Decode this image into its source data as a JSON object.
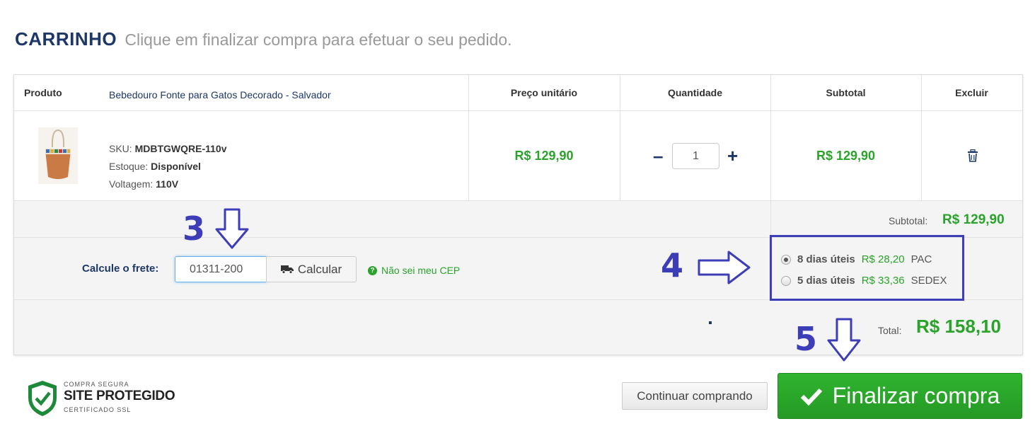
{
  "header": {
    "title": "CARRINHO",
    "subtitle": "Clique em finalizar compra para efetuar o seu pedido."
  },
  "table": {
    "headers": {
      "product": "Produto",
      "unit_price": "Preço unitário",
      "quantity": "Quantidade",
      "subtotal": "Subtotal",
      "remove": "Excluir"
    },
    "items": [
      {
        "name": "Bebedouro Fonte para Gatos Decorado - Salvador",
        "sku_label": "SKU:",
        "sku": "MDBTGWQRE-110v",
        "stock_label": "Estoque:",
        "stock": "Disponível",
        "voltage_label": "Voltagem:",
        "voltage": "110V",
        "unit_price": "R$ 129,90",
        "quantity": "1",
        "subtotal": "R$ 129,90",
        "image_icon": "product-thumbnail-icon"
      }
    ]
  },
  "qty_controls": {
    "minus": "–",
    "plus": "+"
  },
  "summary": {
    "subtotal_label": "Subtotal:",
    "subtotal_value": "R$ 129,90",
    "total_label": "Total:",
    "total_value": "R$ 158,10"
  },
  "shipping": {
    "label": "Calcule o frete:",
    "cep_value": "01311-200",
    "calc_button": "Calcular",
    "help_link": "Não sei meu CEP",
    "options": [
      {
        "days": "8 dias úteis",
        "price": "R$ 28,20",
        "name": "PAC",
        "selected": true
      },
      {
        "days": "5 dias úteis",
        "price": "R$ 33,36",
        "name": "SEDEX",
        "selected": false
      }
    ]
  },
  "annotations": {
    "step3": "3",
    "step4": "4",
    "step5": "5"
  },
  "seal": {
    "line1": "COMPRA SEGURA",
    "line2": "SITE PROTEGIDO",
    "line3": "CERTIFICADO SSL"
  },
  "actions": {
    "continue": "Continuar comprando",
    "checkout": "Finalizar compra"
  },
  "colors": {
    "navy": "#1d3768",
    "green": "#2aa32a",
    "annotation": "#3d3db8"
  }
}
